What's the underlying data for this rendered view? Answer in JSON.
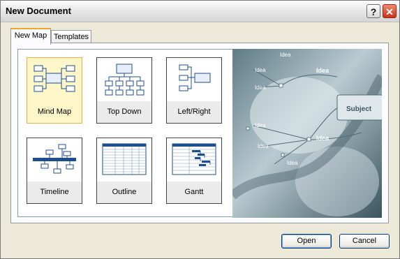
{
  "window": {
    "title": "New Document"
  },
  "titlebar": {
    "help_label": "?",
    "close_label": "✕"
  },
  "tabs": [
    {
      "label": "New Map",
      "active": true
    },
    {
      "label": "Templates",
      "active": false
    }
  ],
  "templates": [
    {
      "label": "Mind Map",
      "icon": "mind-map-icon",
      "selected": true
    },
    {
      "label": "Top Down",
      "icon": "top-down-icon",
      "selected": false
    },
    {
      "label": "Left/Right",
      "icon": "left-right-icon",
      "selected": false
    },
    {
      "label": "Timeline",
      "icon": "timeline-icon",
      "selected": false
    },
    {
      "label": "Outline",
      "icon": "outline-icon",
      "selected": false
    },
    {
      "label": "Gantt",
      "icon": "gantt-icon",
      "selected": false
    }
  ],
  "preview": {
    "subject": "Subject",
    "idea": "Idea"
  },
  "buttons": {
    "open": "Open",
    "cancel": "Cancel"
  },
  "colors": {
    "accent_tab": "#f2a52d",
    "selection": "#fdf6c8",
    "icon_blue": "#1f4e8c"
  }
}
